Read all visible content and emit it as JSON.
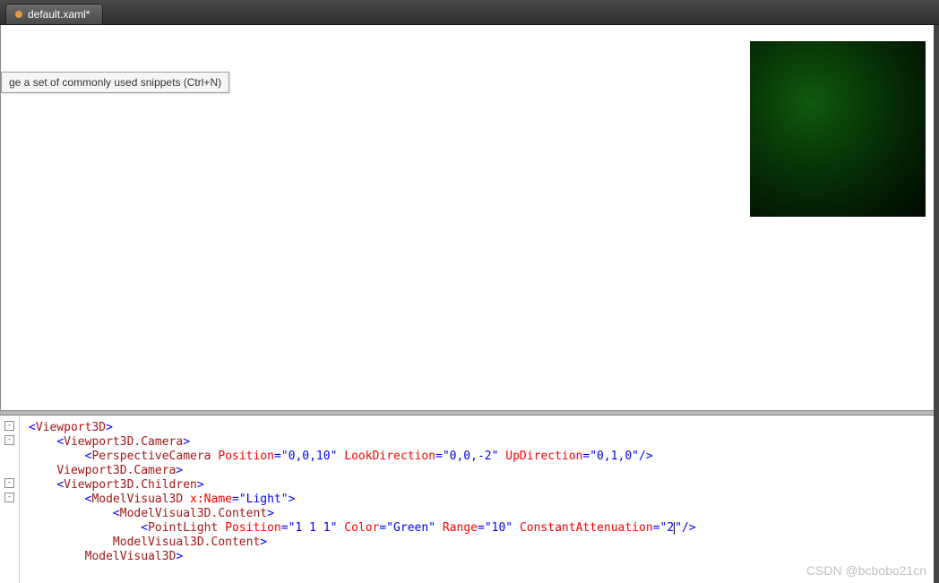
{
  "tab": {
    "title": "default.xaml*"
  },
  "tooltip": {
    "text": "ge a set of commonly used snippets (Ctrl+N)"
  },
  "watermark": "CSDN @bcbobo21cn",
  "code": {
    "lines": [
      {
        "indent": 0,
        "open": "<",
        "elem": "Viewport3D",
        "close": ">"
      },
      {
        "indent": 1,
        "open": "<",
        "elem": "Viewport3D.Camera",
        "close": ">"
      },
      {
        "indent": 2,
        "open": "<",
        "elem": "PerspectiveCamera",
        "attrs": [
          {
            "name": "Position",
            "value": "0,0,10"
          },
          {
            "name": "LookDirection",
            "value": "0,0,-2"
          },
          {
            "name": "UpDirection",
            "value": "0,1,0"
          }
        ],
        "selfclose": "/>"
      },
      {
        "indent": 1,
        "open": "</",
        "elem": "Viewport3D.Camera",
        "close": ">"
      },
      {
        "indent": 1,
        "open": "<",
        "elem": "Viewport3D.Children",
        "close": ">"
      },
      {
        "indent": 2,
        "open": "<",
        "elem": "ModelVisual3D",
        "attrs": [
          {
            "name": "x:Name",
            "value": "Light",
            "xname": true
          }
        ],
        "close": ">"
      },
      {
        "indent": 3,
        "open": "<",
        "elem": "ModelVisual3D.Content",
        "close": ">"
      },
      {
        "indent": 4,
        "open": "<",
        "elem": "PointLight",
        "attrs": [
          {
            "name": "Position",
            "value": "1 1 1"
          },
          {
            "name": "Color",
            "value": "Green"
          },
          {
            "name": "Range",
            "value": "10"
          },
          {
            "name": "ConstantAttenuation",
            "value": "2",
            "caret": true
          }
        ],
        "selfclose": "/>"
      },
      {
        "indent": 3,
        "open": "</",
        "elem": "ModelVisual3D.Content",
        "close": ">"
      },
      {
        "indent": 2,
        "open": "</",
        "elem": "ModelVisual3D",
        "close": ">"
      }
    ],
    "folds": [
      "box",
      "box",
      "line",
      "line",
      "box",
      "box",
      "line",
      "line",
      "line",
      "line"
    ]
  }
}
